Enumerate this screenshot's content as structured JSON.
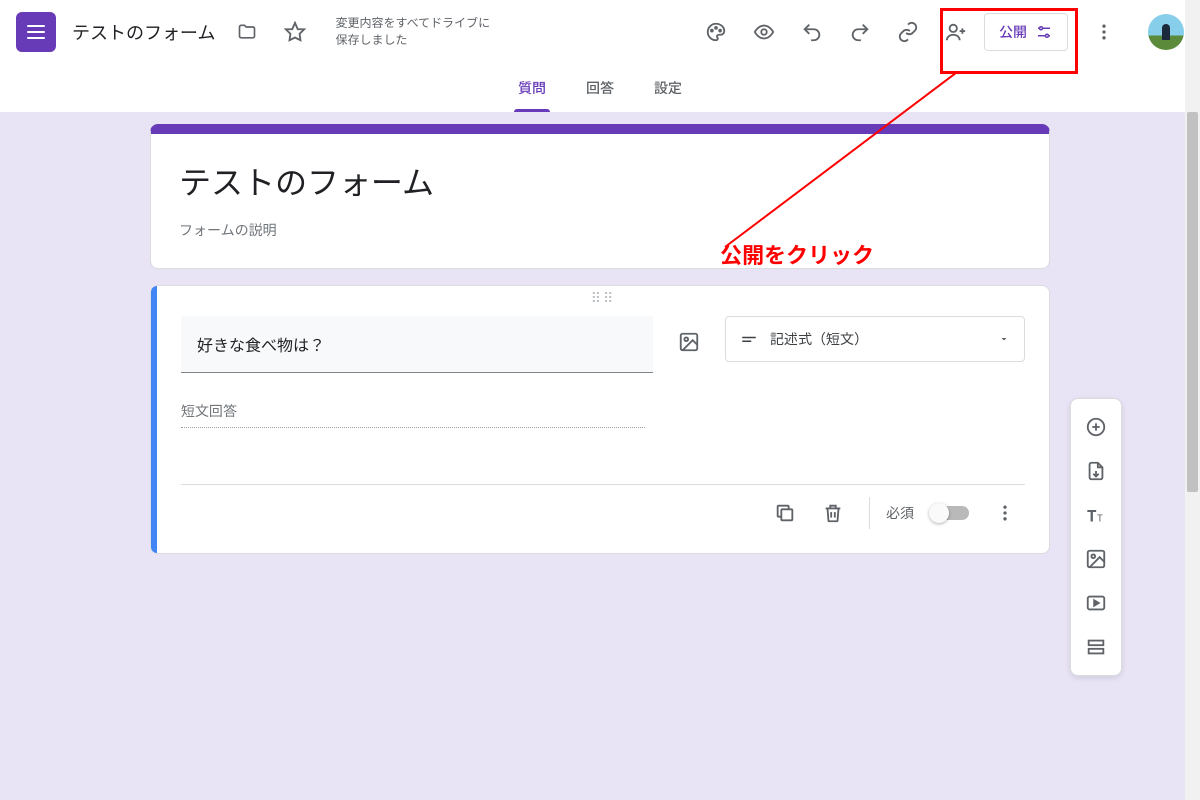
{
  "header": {
    "form_title": "テストのフォーム",
    "save_status_line1": "変更内容をすべてドライブに",
    "save_status_line2": "保存しました",
    "publish_label": "公開"
  },
  "tabs": {
    "questions": "質問",
    "responses": "回答",
    "settings": "設定"
  },
  "title_card": {
    "title": "テストのフォーム",
    "description_placeholder": "フォームの説明"
  },
  "question": {
    "text": "好きな食べ物は？",
    "type_label": "記述式（短文）",
    "answer_placeholder": "短文回答",
    "required_label": "必須"
  },
  "annotation": {
    "text": "公開をクリック"
  },
  "icons": {
    "folder": "folder-icon",
    "star": "star-icon",
    "palette": "palette-icon",
    "preview": "preview-icon",
    "undo": "undo-icon",
    "redo": "redo-icon",
    "link": "link-icon",
    "share": "share-person-icon",
    "tune": "tune-icon",
    "more": "more-vert-icon",
    "image": "image-icon",
    "short_text": "short-text-icon",
    "dropdown": "arrow-drop-down-icon",
    "copy": "copy-icon",
    "delete": "delete-icon",
    "add_circle": "add-circle-icon",
    "import": "import-icon",
    "title_text": "title-text-icon",
    "add_image": "add-image-icon",
    "add_video": "add-video-icon",
    "add_section": "add-section-icon"
  }
}
